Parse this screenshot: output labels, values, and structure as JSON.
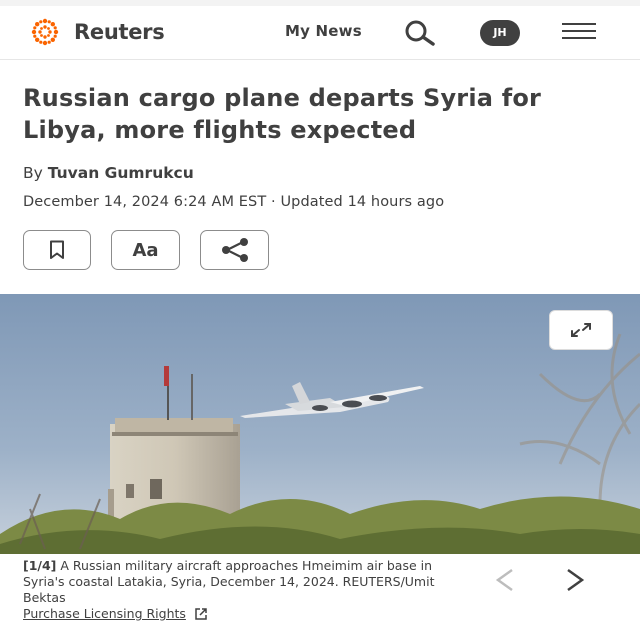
{
  "header": {
    "logo_text": "Reuters",
    "my_news_label": "My News",
    "avatar_initials": "JH"
  },
  "article": {
    "headline": "Russian cargo plane departs Syria for Libya, more flights expected",
    "by_prefix": "By",
    "author": "Tuvan Gumrukcu",
    "dateline": "December 14, 2024 6:24 AM EST · Updated 14 hours ago",
    "text_size_label": "Aa"
  },
  "gallery": {
    "index_label": "[1/4]",
    "caption": "A Russian military aircraft approaches Hmeimim air base in Syria's coastal Latakia, Syria, December 14, 2024. REUTERS/Umit Bektas",
    "license_label": "Purchase Licensing Rights"
  },
  "icons": {
    "search": "search-icon",
    "menu": "hamburger-menu-icon",
    "bookmark": "bookmark-icon",
    "share": "share-icon",
    "expand": "expand-icon",
    "prev": "chevron-left-icon",
    "next": "chevron-right-icon",
    "external": "external-link-icon"
  },
  "colors": {
    "text": "#404040",
    "brand_orange": "#fa6400",
    "border": "#8c8c8c"
  }
}
